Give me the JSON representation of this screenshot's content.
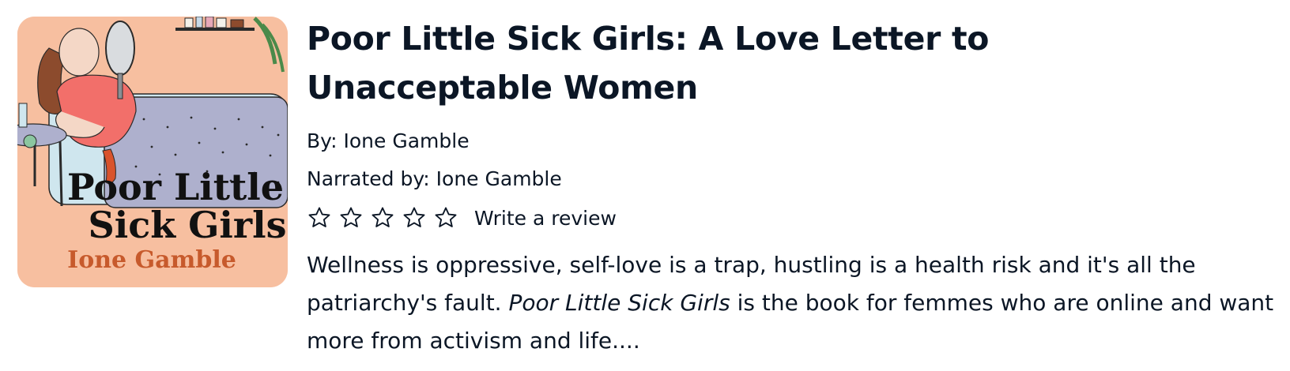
{
  "cover": {
    "title_line1": "Poor Little",
    "title_line2": "Sick Girls",
    "author": "Ione Gamble",
    "colors": {
      "background": "#f7bfa0",
      "bed": "#aeb0cd",
      "sofa": "#cfe6ee",
      "dress": "#f26f6a",
      "author_text": "#c75a2c"
    }
  },
  "book": {
    "title": "Poor Little Sick Girls: A Love Letter to Unacceptable Women",
    "by_label": "By: Ione Gamble",
    "narrated_label": "Narrated by: Ione Gamble",
    "rating": {
      "max_stars": 5,
      "filled_stars": 0,
      "icon": "star-outline-icon",
      "write_review": "Write a review"
    },
    "summary": {
      "part1": "Wellness is oppressive, self-love is a trap, hustling is a health risk and it's all the patriarchy's fault. ",
      "italic": "Poor Little Sick Girls",
      "part2": " is the book for femmes who are online and want more from activism and life...."
    }
  }
}
